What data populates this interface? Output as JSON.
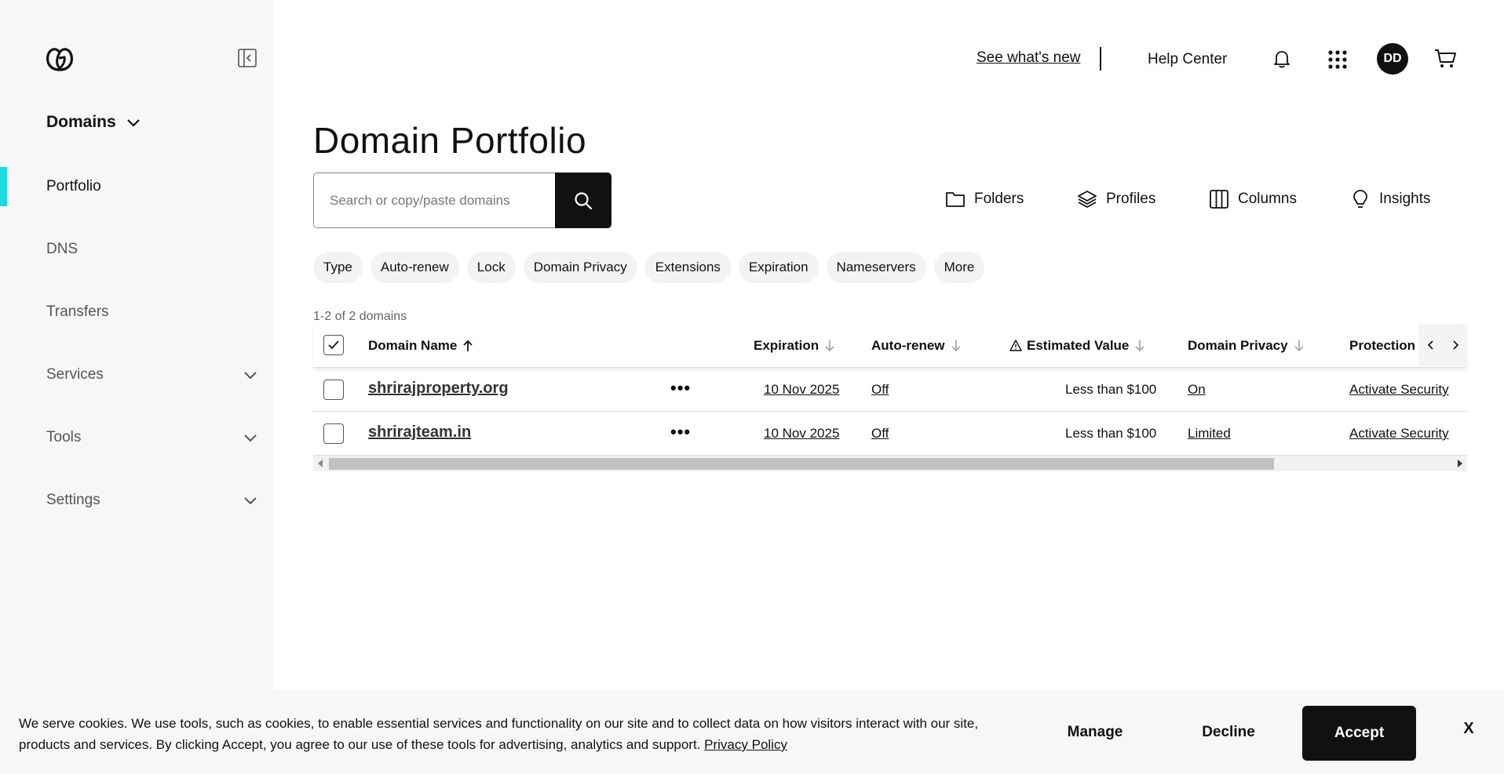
{
  "sidebar": {
    "section_title": "Domains",
    "items": [
      {
        "label": "Portfolio"
      },
      {
        "label": "DNS"
      },
      {
        "label": "Transfers"
      },
      {
        "label": "Services"
      },
      {
        "label": "Tools"
      },
      {
        "label": "Settings"
      }
    ]
  },
  "header": {
    "whats_new": "See what's new",
    "help": "Help Center",
    "avatar_initials": "DD"
  },
  "page": {
    "title": "Domain Portfolio"
  },
  "search": {
    "placeholder": "Search or copy/paste domains"
  },
  "tools": {
    "folders": "Folders",
    "profiles": "Profiles",
    "columns": "Columns",
    "insights": "Insights"
  },
  "filters": [
    "Type",
    "Auto-renew",
    "Lock",
    "Domain Privacy",
    "Extensions",
    "Expiration",
    "Nameservers",
    "More"
  ],
  "table": {
    "count": "1-2 of 2 domains",
    "headers": {
      "domain": "Domain Name",
      "expiration": "Expiration",
      "auto_renew": "Auto-renew",
      "estimated_value": "Estimated Value",
      "privacy": "Domain Privacy",
      "protection": "Protection"
    },
    "rows": [
      {
        "domain": "shrirajproperty.org",
        "expiration": "10 Nov 2025",
        "auto_renew": "Off",
        "value": "Less than $100",
        "privacy": "On",
        "protection": "Activate Security"
      },
      {
        "domain": "shrirajteam.in",
        "expiration": "10 Nov 2025",
        "auto_renew": "Off",
        "value": "Less than $100",
        "privacy": "Limited",
        "protection": "Activate Security"
      }
    ]
  },
  "cookie": {
    "text": "We serve cookies. We use tools, such as cookies, to enable essential services and functionality on our site and to collect data on how visitors interact with our site, products and services. By clicking Accept, you agree to our use of these tools for advertising, analytics and support.",
    "privacy_link": "Privacy Policy",
    "manage": "Manage",
    "decline": "Decline",
    "accept": "Accept",
    "close": "X"
  },
  "colors": {
    "accent": "#1bdbdb",
    "primary": "#111111",
    "sidebar_bg": "#f5f7f8"
  }
}
